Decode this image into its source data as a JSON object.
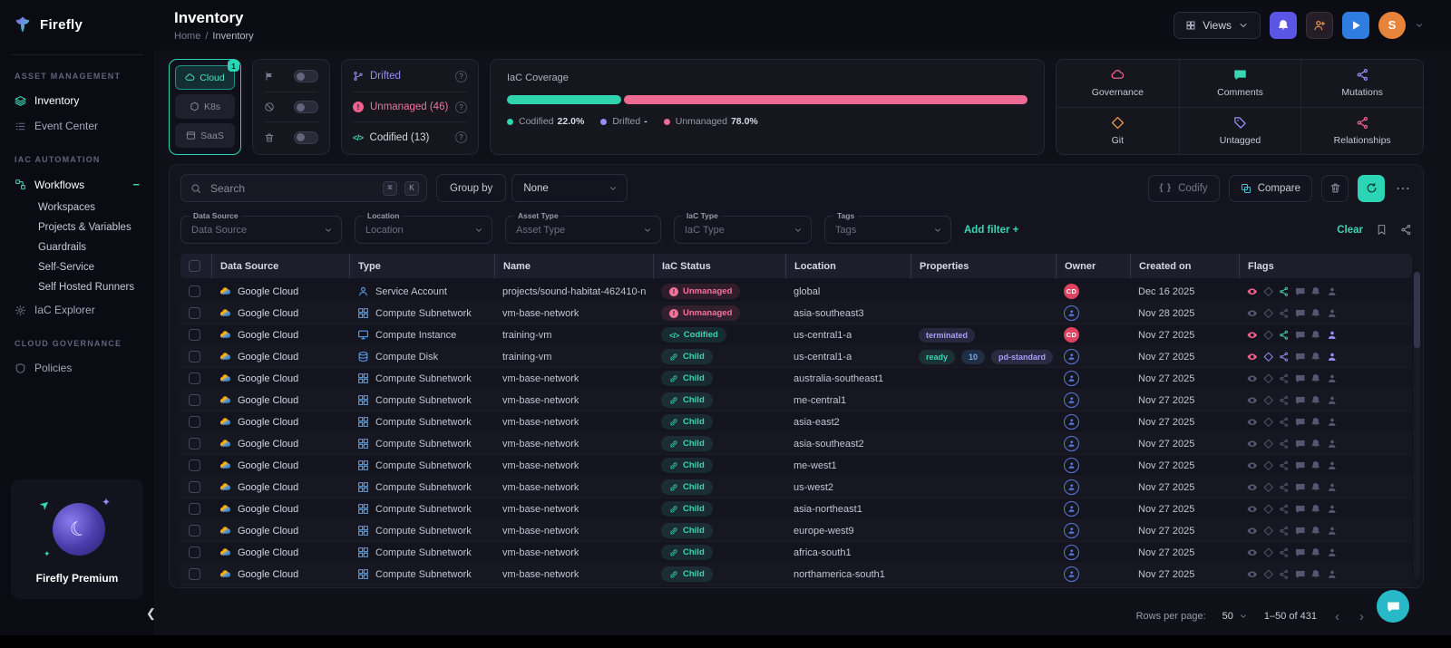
{
  "brand": {
    "name": "Firefly"
  },
  "palette": {
    "teal": "#3ad6b4",
    "pink": "#f0608e",
    "purple": "#9b8cf5",
    "blue": "#5aa2f0",
    "orange": "#f09a4a",
    "red": "#e0435f",
    "gray": "#565670"
  },
  "sidebar": {
    "sections": [
      {
        "title": "ASSET MANAGEMENT",
        "items": [
          {
            "label": "Inventory",
            "icon": "inventory-icon",
            "active": true
          },
          {
            "label": "Event Center",
            "icon": "event-center-icon"
          }
        ]
      },
      {
        "title": "IAC AUTOMATION",
        "items": [
          {
            "label": "Workflows",
            "icon": "workflows-icon",
            "expanded": true,
            "children": [
              "Workspaces",
              "Projects & Variables",
              "Guardrails",
              "Self-Service",
              "Self Hosted Runners"
            ]
          },
          {
            "label": "IaC Explorer",
            "icon": "iac-explorer-icon"
          }
        ]
      },
      {
        "title": "CLOUD GOVERNANCE",
        "items": [
          {
            "label": "Policies",
            "icon": "policies-icon"
          }
        ]
      }
    ],
    "premium_label": "Firefly Premium"
  },
  "header": {
    "title": "Inventory",
    "breadcrumb_home": "Home",
    "breadcrumb_current": "Inventory",
    "views_label": "Views",
    "avatar_initial": "S"
  },
  "providers": {
    "cloud": {
      "label": "Cloud",
      "badge": "1"
    },
    "k8s": {
      "label": "K8s"
    },
    "saas": {
      "label": "SaaS"
    }
  },
  "drift_panel": {
    "drifted": {
      "label": "Drifted"
    },
    "unmanaged": {
      "label": "Unmanaged (46)"
    },
    "codified": {
      "label": "Codified (13)"
    }
  },
  "coverage": {
    "title": "IaC Coverage",
    "codified_pct": 22.0,
    "unmanaged_pct": 78.0,
    "legend": [
      {
        "label": "Codified",
        "value": "22.0%",
        "color": "#2fd4ae"
      },
      {
        "label": "Drifted",
        "value": "-",
        "color": "#9b8cf5"
      },
      {
        "label": "Unmanaged",
        "value": "78.0%",
        "color": "#ef6a93"
      }
    ]
  },
  "categories": [
    {
      "label": "Governance",
      "icon": "governance-icon",
      "color": "#f0608e"
    },
    {
      "label": "Comments",
      "icon": "comments-icon",
      "color": "#3ad6b4"
    },
    {
      "label": "Mutations",
      "icon": "mutations-icon",
      "color": "#9b8cf5"
    },
    {
      "label": "Git",
      "icon": "git-icon",
      "color": "#f09a4a"
    },
    {
      "label": "Untagged",
      "icon": "untagged-icon",
      "color": "#9b8cf5"
    },
    {
      "label": "Relationships",
      "icon": "relationships-icon",
      "color": "#f0608e"
    }
  ],
  "toolbar": {
    "search_placeholder": "Search",
    "shortcut_keys": [
      "⌘",
      "K"
    ],
    "group_by_label": "Group by",
    "group_by_value": "None",
    "codify_prefix": "{ }",
    "codify_label": "Codify",
    "compare_label": "Compare"
  },
  "filters": {
    "dropdowns": [
      {
        "label": "Data Source",
        "placeholder": "Data Source"
      },
      {
        "label": "Location",
        "placeholder": "Location"
      },
      {
        "label": "Asset Type",
        "placeholder": "Asset Type"
      },
      {
        "label": "IaC Type",
        "placeholder": "IaC Type"
      },
      {
        "label": "Tags",
        "placeholder": "Tags"
      }
    ],
    "add_filter_label": "Add filter +",
    "clear_label": "Clear"
  },
  "table": {
    "columns": [
      "Data Source",
      "Type",
      "Name",
      "IaC Status",
      "Location",
      "Properties",
      "Owner",
      "Created on",
      "Flags"
    ],
    "status_colors": {
      "Unmanaged": "pink",
      "Codified": "teal",
      "Child": "teal"
    },
    "rows": [
      {
        "source": "Google Cloud",
        "source_icon": "google-cloud-icon",
        "type": "Service Account",
        "type_icon": "service-account-icon",
        "name": "projects/sound-habitat-462410-n",
        "status": "Unmanaged",
        "location": "global",
        "properties": [],
        "owner": "CD",
        "created": "Dec 16 2025",
        "flags": [
          "eye:pink",
          "git",
          "nodes:teal",
          "comment",
          "bell",
          "person"
        ]
      },
      {
        "source": "Google Cloud",
        "source_icon": "google-cloud-icon",
        "type": "Compute Subnetwork",
        "type_icon": "compute-subnetwork-icon",
        "name": "vm-base-network",
        "status": "Unmanaged",
        "location": "asia-southeast3",
        "properties": [],
        "owner": "user",
        "created": "Nov 28 2025",
        "flags": [
          "eye",
          "git",
          "nodes",
          "comment",
          "bell",
          "person"
        ]
      },
      {
        "source": "Google Cloud",
        "source_icon": "google-cloud-icon",
        "type": "Compute Instance",
        "type_icon": "compute-instance-icon",
        "name": "training-vm",
        "status": "Codified",
        "location": "us-central1-a",
        "properties": [
          {
            "label": "terminated",
            "color": "purple"
          }
        ],
        "owner": "CD",
        "created": "Nov 27 2025",
        "flags": [
          "eye:pink",
          "git",
          "nodes:teal",
          "comment",
          "bell",
          "person:purple"
        ]
      },
      {
        "source": "Google Cloud",
        "source_icon": "google-cloud-icon",
        "type": "Compute Disk",
        "type_icon": "compute-disk-icon",
        "name": "training-vm",
        "status": "Child",
        "location": "us-central1-a",
        "properties": [
          {
            "label": "ready",
            "color": "teal"
          },
          {
            "label": "10",
            "color": "blue"
          },
          {
            "label": "pd-standard",
            "color": "purple"
          }
        ],
        "owner": "user",
        "created": "Nov 27 2025",
        "flags": [
          "eye:pink",
          "git:purple",
          "nodes:purple",
          "comment",
          "bell",
          "person:purple"
        ]
      },
      {
        "source": "Google Cloud",
        "source_icon": "google-cloud-icon",
        "type": "Compute Subnetwork",
        "type_icon": "compute-subnetwork-icon",
        "name": "vm-base-network",
        "status": "Child",
        "location": "australia-southeast1",
        "properties": [],
        "owner": "user",
        "created": "Nov 27 2025",
        "flags": [
          "eye",
          "git",
          "nodes",
          "comment",
          "bell",
          "person"
        ]
      },
      {
        "source": "Google Cloud",
        "source_icon": "google-cloud-icon",
        "type": "Compute Subnetwork",
        "type_icon": "compute-subnetwork-icon",
        "name": "vm-base-network",
        "status": "Child",
        "location": "me-central1",
        "properties": [],
        "owner": "user",
        "created": "Nov 27 2025",
        "flags": [
          "eye",
          "git",
          "nodes",
          "comment",
          "bell",
          "person"
        ]
      },
      {
        "source": "Google Cloud",
        "source_icon": "google-cloud-icon",
        "type": "Compute Subnetwork",
        "type_icon": "compute-subnetwork-icon",
        "name": "vm-base-network",
        "status": "Child",
        "location": "asia-east2",
        "properties": [],
        "owner": "user",
        "created": "Nov 27 2025",
        "flags": [
          "eye",
          "git",
          "nodes",
          "comment",
          "bell",
          "person"
        ]
      },
      {
        "source": "Google Cloud",
        "source_icon": "google-cloud-icon",
        "type": "Compute Subnetwork",
        "type_icon": "compute-subnetwork-icon",
        "name": "vm-base-network",
        "status": "Child",
        "location": "asia-southeast2",
        "properties": [],
        "owner": "user",
        "created": "Nov 27 2025",
        "flags": [
          "eye",
          "git",
          "nodes",
          "comment",
          "bell",
          "person"
        ]
      },
      {
        "source": "Google Cloud",
        "source_icon": "google-cloud-icon",
        "type": "Compute Subnetwork",
        "type_icon": "compute-subnetwork-icon",
        "name": "vm-base-network",
        "status": "Child",
        "location": "me-west1",
        "properties": [],
        "owner": "user",
        "created": "Nov 27 2025",
        "flags": [
          "eye",
          "git",
          "nodes",
          "comment",
          "bell",
          "person"
        ]
      },
      {
        "source": "Google Cloud",
        "source_icon": "google-cloud-icon",
        "type": "Compute Subnetwork",
        "type_icon": "compute-subnetwork-icon",
        "name": "vm-base-network",
        "status": "Child",
        "location": "us-west2",
        "properties": [],
        "owner": "user",
        "created": "Nov 27 2025",
        "flags": [
          "eye",
          "git",
          "nodes",
          "comment",
          "bell",
          "person"
        ]
      },
      {
        "source": "Google Cloud",
        "source_icon": "google-cloud-icon",
        "type": "Compute Subnetwork",
        "type_icon": "compute-subnetwork-icon",
        "name": "vm-base-network",
        "status": "Child",
        "location": "asia-northeast1",
        "properties": [],
        "owner": "user",
        "created": "Nov 27 2025",
        "flags": [
          "eye",
          "git",
          "nodes",
          "comment",
          "bell",
          "person"
        ]
      },
      {
        "source": "Google Cloud",
        "source_icon": "google-cloud-icon",
        "type": "Compute Subnetwork",
        "type_icon": "compute-subnetwork-icon",
        "name": "vm-base-network",
        "status": "Child",
        "location": "europe-west9",
        "properties": [],
        "owner": "user",
        "created": "Nov 27 2025",
        "flags": [
          "eye",
          "git",
          "nodes",
          "comment",
          "bell",
          "person"
        ]
      },
      {
        "source": "Google Cloud",
        "source_icon": "google-cloud-icon",
        "type": "Compute Subnetwork",
        "type_icon": "compute-subnetwork-icon",
        "name": "vm-base-network",
        "status": "Child",
        "location": "africa-south1",
        "properties": [],
        "owner": "user",
        "created": "Nov 27 2025",
        "flags": [
          "eye",
          "git",
          "nodes",
          "comment",
          "bell",
          "person"
        ]
      },
      {
        "source": "Google Cloud",
        "source_icon": "google-cloud-icon",
        "type": "Compute Subnetwork",
        "type_icon": "compute-subnetwork-icon",
        "name": "vm-base-network",
        "status": "Child",
        "location": "northamerica-south1",
        "properties": [],
        "owner": "user",
        "created": "Nov 27 2025",
        "flags": [
          "eye",
          "git",
          "nodes",
          "comment",
          "bell",
          "person"
        ]
      }
    ]
  },
  "pagination": {
    "rows_per_page_label": "Rows per page:",
    "rows_per_page_value": "50",
    "range_label": "1–50 of 431"
  }
}
